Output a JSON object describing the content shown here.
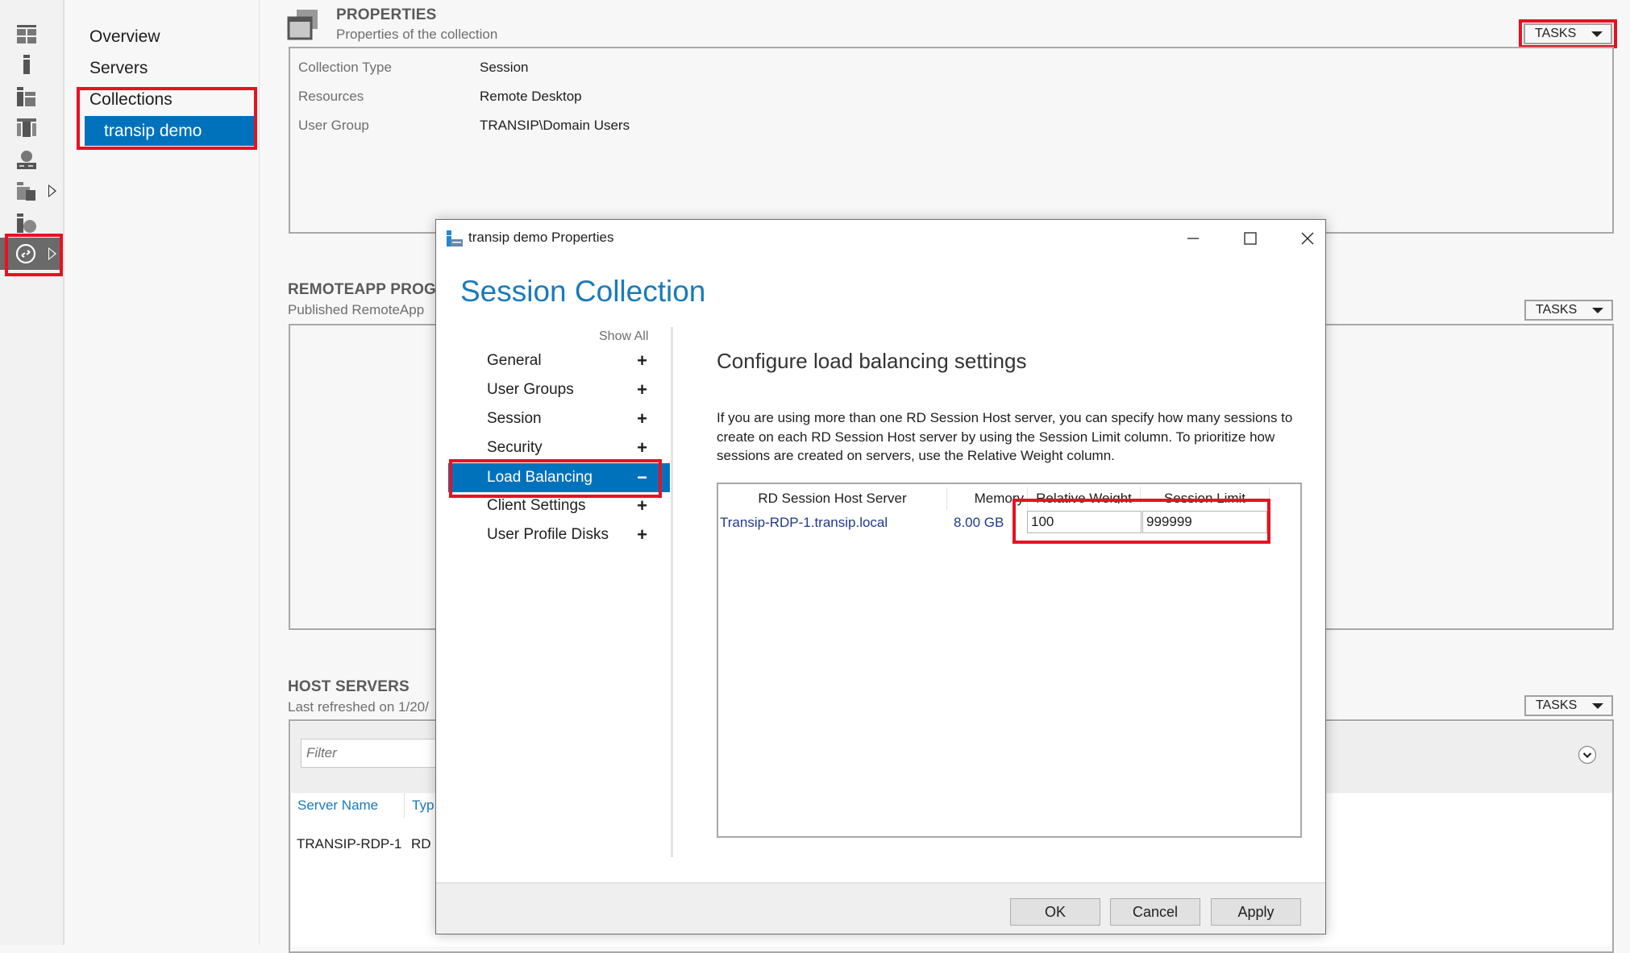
{
  "sidebar_icons": [
    {
      "name": "dashboard-icon"
    },
    {
      "name": "local-server-icon"
    },
    {
      "name": "all-servers-icon"
    },
    {
      "name": "file-storage-icon"
    },
    {
      "name": "iis-icon"
    },
    {
      "name": "remote-desktop-services-icon",
      "expandable": true
    },
    {
      "name": "web-server-icon"
    },
    {
      "name": "rds-collections-icon",
      "expandable": true,
      "selected": true
    }
  ],
  "nav": {
    "items": [
      {
        "label": "Overview"
      },
      {
        "label": "Servers"
      },
      {
        "label": "Collections"
      }
    ],
    "selected_sub": "transip demo"
  },
  "properties": {
    "title": "PROPERTIES",
    "subtitle": "Properties of the collection",
    "tasks_label": "TASKS",
    "rows": [
      {
        "label": "Collection Type",
        "value": "Session"
      },
      {
        "label": "Resources",
        "value": "Remote Desktop"
      },
      {
        "label": "User Group",
        "value": "TRANSIP\\Domain Users"
      }
    ]
  },
  "remoteapp": {
    "title": "REMOTEAPP PROG",
    "subtitle": "Published RemoteApp",
    "tasks_label": "TASKS"
  },
  "host_servers": {
    "title": "HOST SERVERS",
    "subtitle": "Last refreshed on 1/20/",
    "tasks_label": "TASKS",
    "filter_placeholder": "Filter",
    "columns": [
      "Server Name",
      "Typ"
    ],
    "rows": [
      [
        "TRANSIP-RDP-1",
        "RD"
      ]
    ]
  },
  "dialog": {
    "title": "transip demo Properties",
    "heading": "Session Collection",
    "show_all": "Show All",
    "nav": [
      {
        "label": "General",
        "sign": "+"
      },
      {
        "label": "User Groups",
        "sign": "+"
      },
      {
        "label": "Session",
        "sign": "+"
      },
      {
        "label": "Security",
        "sign": "+"
      },
      {
        "label": "Load Balancing",
        "sign": "−",
        "active": true
      },
      {
        "label": "Client Settings",
        "sign": "+"
      },
      {
        "label": "User Profile Disks",
        "sign": "+"
      }
    ],
    "config_heading": "Configure load balancing settings",
    "config_description": "If you are using more than one RD Session Host server, you can specify how many sessions to create on each RD Session Host server by using the Session Limit column. To prioritize how sessions are created on servers, use the Relative Weight column.",
    "table": {
      "columns": [
        "RD Session Host Server",
        "Memory",
        "Relative Weight",
        "Session Limit"
      ],
      "rows": [
        {
          "server": "Transip-RDP-1.transip.local",
          "memory": "8.00 GB",
          "relative_weight": "100",
          "session_limit": "999999"
        }
      ]
    },
    "buttons": {
      "ok": "OK",
      "cancel": "Cancel",
      "apply": "Apply"
    }
  },
  "colors": {
    "accent": "#0072bc",
    "heading_blue": "#1a7ab8",
    "highlight_red": "#e81123",
    "selected_strip": "#6a6a6a"
  }
}
